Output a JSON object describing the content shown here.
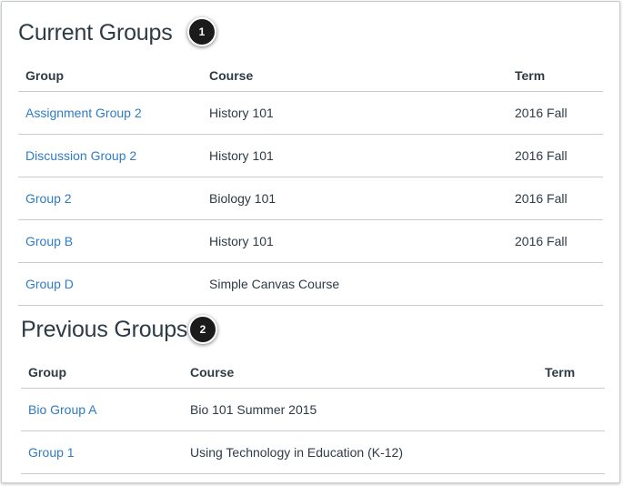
{
  "current": {
    "title": "Current Groups",
    "badge": "1",
    "headers": {
      "group": "Group",
      "course": "Course",
      "term": "Term"
    },
    "rows": [
      {
        "group": "Assignment Group 2",
        "course": "History 101",
        "term": "2016 Fall"
      },
      {
        "group": "Discussion Group 2",
        "course": "History 101",
        "term": "2016 Fall"
      },
      {
        "group": "Group 2",
        "course": "Biology 101",
        "term": "2016 Fall"
      },
      {
        "group": "Group B",
        "course": "History 101",
        "term": "2016 Fall"
      },
      {
        "group": "Group D",
        "course": "Simple Canvas Course",
        "term": ""
      }
    ]
  },
  "previous": {
    "title": "Previous Groups",
    "badge": "2",
    "headers": {
      "group": "Group",
      "course": "Course",
      "term": "Term"
    },
    "rows": [
      {
        "group": "Bio Group A",
        "course": "Bio 101 Summer 2015",
        "term": ""
      },
      {
        "group": "Group 1",
        "course": "Using Technology in Education (K-12)",
        "term": ""
      }
    ]
  },
  "colors": {
    "link": "#2f7bc4",
    "text": "#2d3b45",
    "divider": "#c7cdd1",
    "badge": "#1b1b1b"
  }
}
